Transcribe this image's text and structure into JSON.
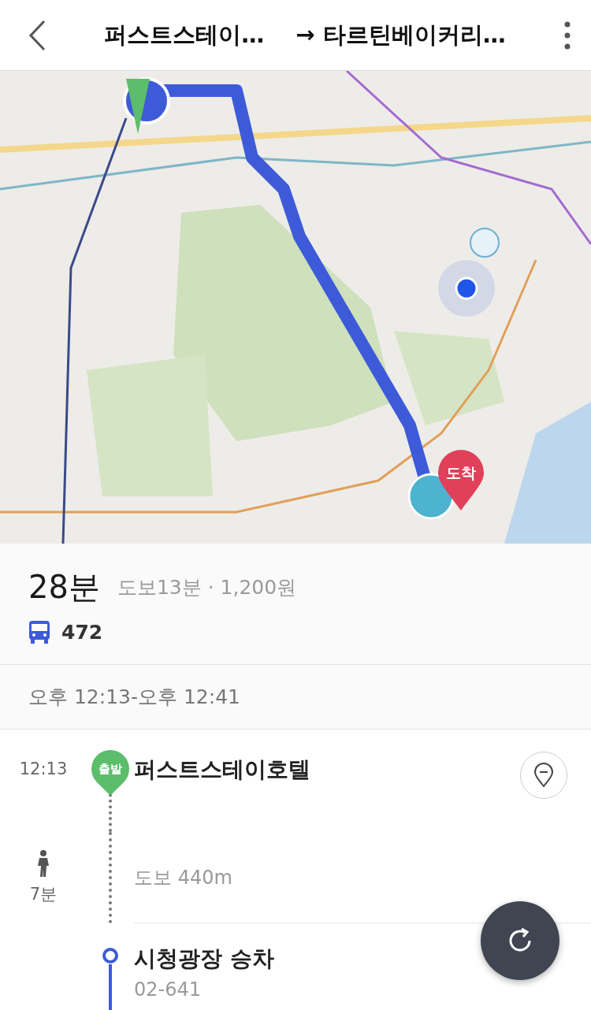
{
  "header": {
    "origin": "퍼스트스테이…",
    "destination": "→ 타르틴베이커리…"
  },
  "map": {
    "kind": "picture",
    "arrival_pin": "도착"
  },
  "summary": {
    "total": "28분",
    "detail": "도보13분 · 1,200원",
    "bus": "472"
  },
  "time_range": "오후 12:13-오후 12:41",
  "steps": [
    {
      "kind": "start",
      "time": "12:13",
      "pin": "출발",
      "title": "퍼스트스테이호텔"
    },
    {
      "kind": "walk",
      "duration": "7분",
      "title": "도보 440m"
    },
    {
      "kind": "board",
      "title": "시청광장 승차",
      "sub": "02-641"
    }
  ]
}
